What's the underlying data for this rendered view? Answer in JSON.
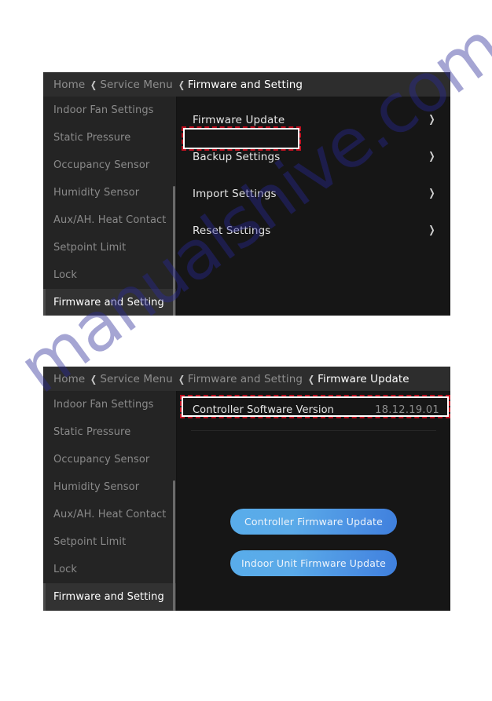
{
  "watermark": {
    "text": "manualshive.com"
  },
  "panels": [
    {
      "id": "firmware-and-setting",
      "breadcrumb": [
        {
          "label": "Home",
          "active": false
        },
        {
          "label": "Service Menu",
          "active": false
        },
        {
          "label": "Firmware and Setting",
          "active": true
        }
      ],
      "sidebar": {
        "items": [
          {
            "label": "Indoor Fan Settings",
            "active": false
          },
          {
            "label": "Static Pressure",
            "active": false
          },
          {
            "label": "Occupancy Sensor",
            "active": false
          },
          {
            "label": "Humidity Sensor",
            "active": false
          },
          {
            "label": "Aux/AH. Heat Contact",
            "active": false
          },
          {
            "label": "Setpoint Limit",
            "active": false
          },
          {
            "label": "Lock",
            "active": false
          },
          {
            "label": "Firmware and Setting",
            "active": true
          }
        ]
      },
      "menu_items": [
        {
          "label": "Firmware Update",
          "chevron": "chevron-right-icon",
          "highlighted": true
        },
        {
          "label": "Backup Settings",
          "chevron": "chevron-right-icon",
          "highlighted": false
        },
        {
          "label": "Import Settings",
          "chevron": "chevron-right-icon",
          "highlighted": false
        },
        {
          "label": "Reset Settings",
          "chevron": "chevron-right-icon",
          "highlighted": false
        }
      ]
    },
    {
      "id": "firmware-update",
      "breadcrumb": [
        {
          "label": "Home",
          "active": false
        },
        {
          "label": "Service Menu",
          "active": false
        },
        {
          "label": "Firmware and Setting",
          "active": false
        },
        {
          "label": "Firmware Update",
          "active": true
        }
      ],
      "sidebar": {
        "items": [
          {
            "label": "Indoor Fan Settings",
            "active": false
          },
          {
            "label": "Static Pressure",
            "active": false
          },
          {
            "label": "Occupancy Sensor",
            "active": false
          },
          {
            "label": "Humidity Sensor",
            "active": false
          },
          {
            "label": "Aux/AH. Heat Contact",
            "active": false
          },
          {
            "label": "Setpoint Limit",
            "active": false
          },
          {
            "label": "Lock",
            "active": false
          },
          {
            "label": "Firmware and Setting",
            "active": true
          }
        ]
      },
      "version_row": {
        "label": "Controller Software Version",
        "value": "18.12.19.01",
        "highlighted": true
      },
      "buttons": [
        {
          "label": "Controller Firmware Update"
        },
        {
          "label": "Indoor Unit Firmware Update"
        }
      ]
    }
  ],
  "glyphs": {
    "chevron_left": "❮",
    "chevron_right": "❯"
  },
  "colors": {
    "panel_bg": "#1a1a1a",
    "content_bg": "#161616",
    "sidebar_bg": "#242424",
    "breadcrumb_bg": "#2d2d2d",
    "active_item_bg": "#323232",
    "highlight_border": "#c01020",
    "button_blue_start": "#59acea",
    "button_blue_end": "#3f7fdd",
    "text_primary": "#e6e6e6",
    "text_muted": "#8a8a8a"
  }
}
